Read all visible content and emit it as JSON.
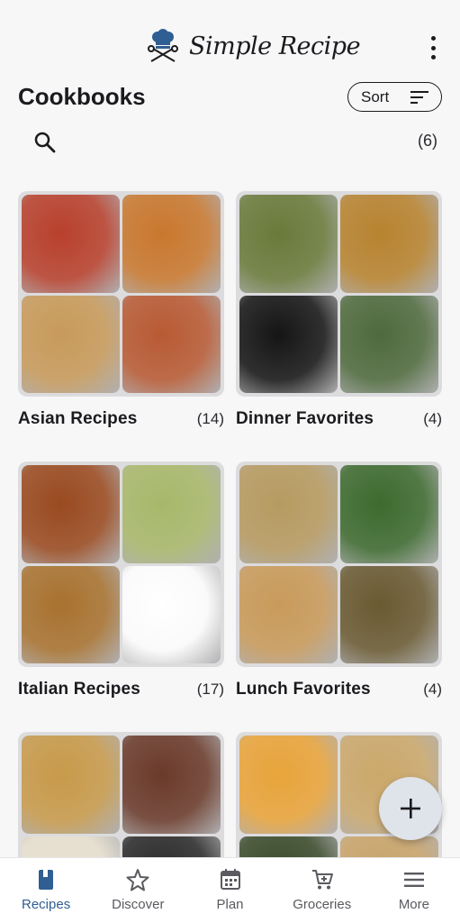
{
  "app": {
    "logo_text": "Simple Recipe"
  },
  "header": {
    "title": "Cookbooks",
    "sort_label": "Sort",
    "count": "(6)"
  },
  "cookbooks": [
    {
      "name": "Asian Recipes",
      "count": "(14)",
      "colors": [
        "#b8402c",
        "#c9782e",
        "#c89a5a",
        "#b85a33"
      ]
    },
    {
      "name": "Dinner Favorites",
      "count": "(4)",
      "colors": [
        "#6a7a3a",
        "#b7832f",
        "#151515",
        "#4f6a3d"
      ]
    },
    {
      "name": "Italian Recipes",
      "count": "(17)",
      "colors": [
        "#9a4a1f",
        "#a8b86a",
        "#a8722f",
        "#ffffff"
      ]
    },
    {
      "name": "Lunch Favorites",
      "count": "(4)",
      "colors": [
        "#b69a60",
        "#3d6a2e",
        "#c99a5a",
        "#6a5a32"
      ]
    },
    {
      "name": "",
      "count": "",
      "colors": [
        "#c89a4a",
        "#6a3a2a",
        "#e8e0cf",
        "#2a2a2a"
      ]
    },
    {
      "name": "",
      "count": "",
      "colors": [
        "#e9a43a",
        "#cba86a",
        "#3a4a2a",
        "#c9a46a"
      ]
    }
  ],
  "bottom_nav": [
    {
      "label": "Recipes",
      "icon": "book-icon",
      "active": true
    },
    {
      "label": "Discover",
      "icon": "star-icon",
      "active": false
    },
    {
      "label": "Plan",
      "icon": "calendar-icon",
      "active": false
    },
    {
      "label": "Groceries",
      "icon": "cart-icon",
      "active": false
    },
    {
      "label": "More",
      "icon": "hamburger-icon",
      "active": false
    }
  ],
  "fab": {
    "icon": "plus-icon"
  },
  "colors": {
    "accent": "#2f5e93",
    "logo_blue": "#2f5e93"
  }
}
